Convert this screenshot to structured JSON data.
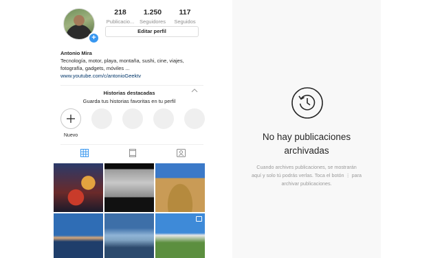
{
  "profile": {
    "stats": [
      {
        "value": "218",
        "label": "Publicacio..."
      },
      {
        "value": "1.250",
        "label": "Seguidores"
      },
      {
        "value": "117",
        "label": "Seguidos"
      }
    ],
    "edit_button": "Editar perfil",
    "name": "Antonio Mira",
    "bio_line1": "Tecnología, motor, playa, montaña, sushi, cine, viajes,",
    "bio_line2": "fotografía, gadgets, móviles ...",
    "link": "www.youtube.com/c/antonioGeektv"
  },
  "highlights": {
    "title": "Historias destacadas",
    "subtitle": "Guarda tus historias favoritas en tu perfil",
    "new_label": "Nuevo"
  },
  "archive": {
    "title_line1": "No hay publicaciones",
    "title_line2": "archivadas",
    "desc_line1": "Cuando archives publicaciones, se mostrarán",
    "desc_line2": "aquí y solo tú podrás verlas. Toca el botón ⋮ para",
    "desc_line3": "archivar publicaciones."
  },
  "colors": {
    "accent": "#3897f0",
    "link": "#003569",
    "muted": "#8e8e8e"
  },
  "icons": [
    "plus-icon",
    "grid-icon",
    "portrait-icon",
    "tagged-icon",
    "archive-clock-icon",
    "chevron-up-icon",
    "multi-post-icon"
  ]
}
